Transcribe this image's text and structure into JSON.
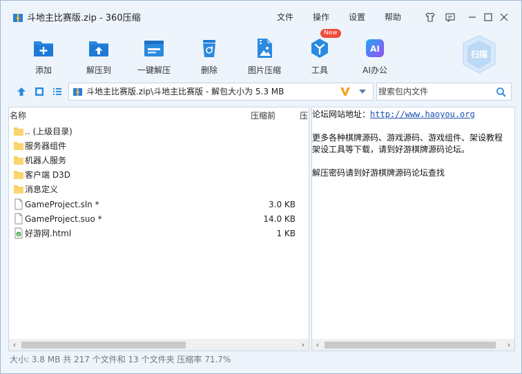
{
  "window": {
    "title": "斗地主比赛版.zip - 360压缩"
  },
  "menu": [
    "文件",
    "操作",
    "设置",
    "帮助"
  ],
  "toolbar": [
    {
      "label": "添加",
      "icon": "add-folder-icon"
    },
    {
      "label": "解压到",
      "icon": "extract-to-icon"
    },
    {
      "label": "一键解压",
      "icon": "one-click-extract-icon"
    },
    {
      "label": "删除",
      "icon": "trash-icon"
    },
    {
      "label": "图片压缩",
      "icon": "image-compress-icon"
    },
    {
      "label": "工具",
      "icon": "tools-icon",
      "badge": "New"
    },
    {
      "label": "AI办公",
      "icon": "ai-office-icon"
    }
  ],
  "scan_label": "扫描",
  "address": {
    "path": "斗地主比赛版.zip\\斗地主比赛版 - 解包大小为 5.3 MB"
  },
  "search": {
    "placeholder": "搜索包内文件"
  },
  "columns": {
    "name": "名称",
    "packed": "压缩前",
    "extra": "压"
  },
  "files": [
    {
      "name": ".. (上级目录)",
      "size": "",
      "type": "folder"
    },
    {
      "name": "服务器组件",
      "size": "",
      "type": "folder"
    },
    {
      "name": "机器人服务",
      "size": "",
      "type": "folder"
    },
    {
      "name": "客户端 D3D",
      "size": "",
      "type": "folder"
    },
    {
      "name": "消息定义",
      "size": "",
      "type": "folder"
    },
    {
      "name": "GameProject.sln *",
      "size": "3.0 KB",
      "type": "file"
    },
    {
      "name": "GameProject.suo *",
      "size": "14.0 KB",
      "type": "file"
    },
    {
      "name": "好游网.html",
      "size": "1 KB",
      "type": "html"
    }
  ],
  "comment": {
    "line1_label": "论坛网站地址：",
    "line1_link": "http://www.haoyou.org",
    "line2": "更多各种棋牌源码、游戏源码、游戏组件、架设教程",
    "line3": "架设工具等下载，请到好游棋牌源码论坛。",
    "line4": "解压密码请到好游棋牌源码论坛查找"
  },
  "status": "大小: 3.8 MB 共 217 个文件和 13 个文件夹 压缩率 71.7%",
  "colors": {
    "accent": "#2a8ae0",
    "folder": "#f8cf61",
    "bg": "#eef4fb"
  }
}
